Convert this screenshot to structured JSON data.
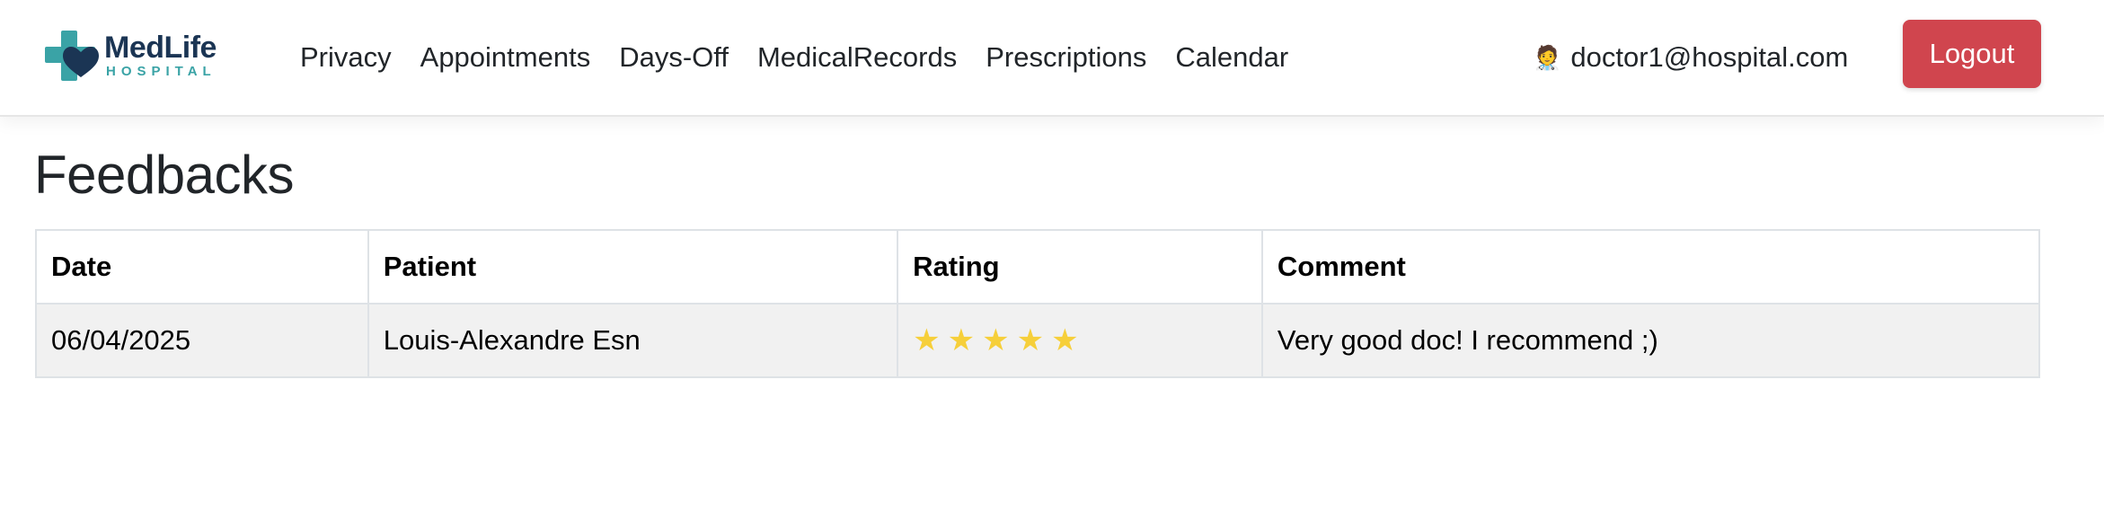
{
  "brand": {
    "name": "MedLife",
    "subtitle": "HOSPITAL",
    "colors": {
      "navy": "#1b3554",
      "teal": "#3aa3a6"
    }
  },
  "nav": {
    "items": [
      {
        "label": "Privacy"
      },
      {
        "label": "Appointments"
      },
      {
        "label": "Days-Off"
      },
      {
        "label": "MedicalRecords"
      },
      {
        "label": "Prescriptions"
      },
      {
        "label": "Calendar"
      }
    ]
  },
  "user": {
    "icon": "doctor-emoji",
    "icon_glyph": "🧑‍⚕️",
    "email": "doctor1@hospital.com"
  },
  "logout": {
    "label": "Logout",
    "color": "#d0454e"
  },
  "page": {
    "title": "Feedbacks"
  },
  "table": {
    "headers": [
      "Date",
      "Patient",
      "Rating",
      "Comment"
    ],
    "rows": [
      {
        "date": "06/04/2025",
        "patient": "Louis-Alexandre Esn",
        "rating": 5,
        "stars": "★★★★★",
        "comment": "Very good doc! I recommend ;)"
      }
    ]
  },
  "colors": {
    "star": "#f6cf3a",
    "row_bg": "#f1f1f1"
  }
}
